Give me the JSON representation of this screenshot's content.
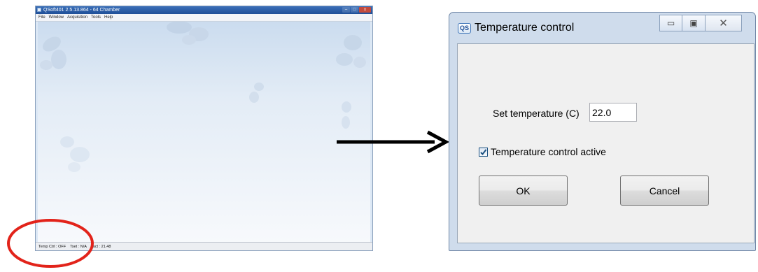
{
  "main_window": {
    "title": "QSoft401 2.5.13.864 - 64 Chamber",
    "controls": {
      "minimize": "–",
      "maximize": "□",
      "close": "x"
    },
    "menu": [
      "File",
      "Window",
      "Acquisition",
      "Tools",
      "Help"
    ],
    "status": {
      "temp_ctrl": "Temp Ctrl : OFF",
      "tset": "Tset : N/A",
      "tact": "Tact : 21.48"
    }
  },
  "dialog": {
    "icon_text": "QS",
    "title": "Temperature control",
    "controls": {
      "minimize": "▭",
      "maximize": "▣",
      "close": "✕"
    },
    "set_temperature_label": "Set temperature (C)",
    "set_temperature_value": "22.0",
    "checkbox_label": "Temperature control active",
    "checkbox_checked": true,
    "ok_label": "OK",
    "cancel_label": "Cancel"
  },
  "colors": {
    "annotation_ring": "#e2231a",
    "arrow": "#000000",
    "title_bar": "#2a5ea8",
    "checkmark": "#1c5180"
  }
}
